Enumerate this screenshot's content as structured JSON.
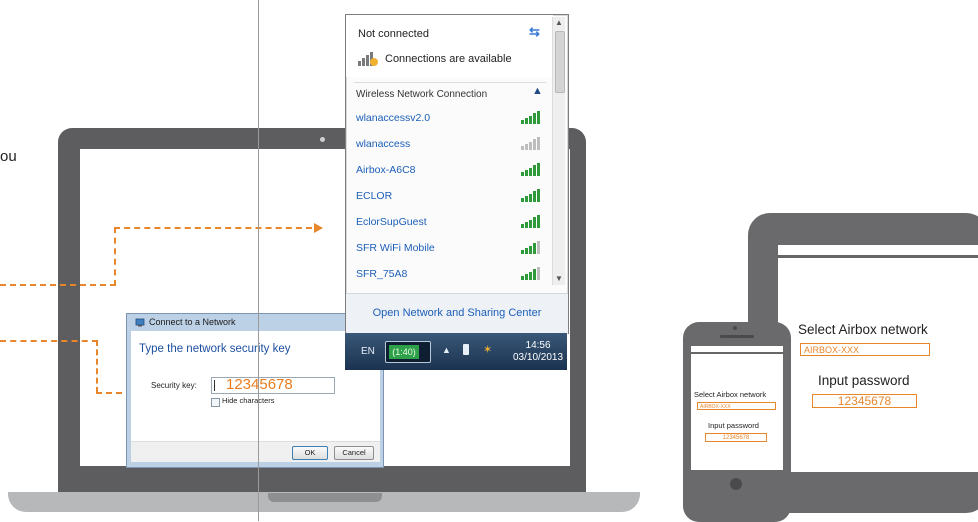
{
  "side_text": "ou",
  "flyout": {
    "status": "Not connected",
    "available": "Connections are available",
    "section": "Wireless Network Connection",
    "networks": [
      {
        "name": "wlanaccessv2.0",
        "signal": 5
      },
      {
        "name": "wlanaccess",
        "signal": 5
      },
      {
        "name": "Airbox-A6C8",
        "signal": 5
      },
      {
        "name": "ECLOR",
        "signal": 5
      },
      {
        "name": "EclorSupGuest",
        "signal": 5
      },
      {
        "name": "SFR WiFi Mobile",
        "signal": 4
      },
      {
        "name": "SFR_75A8",
        "signal": 4
      }
    ],
    "footer_link": "Open Network and Sharing Center"
  },
  "taskbar": {
    "lang": "EN",
    "battery": "(1:40)",
    "time": "14:56",
    "date": "03/10/2013"
  },
  "dialog": {
    "title": "Connect to a Network",
    "heading": "Type the network security key",
    "key_label": "Security key:",
    "key_value": "12345678",
    "hide_label": "Hide characters",
    "ok": "OK",
    "cancel": "Cancel"
  },
  "tablet": {
    "select_label": "Select Airbox network",
    "network_value": "AIRBOX-XXX",
    "password_label": "Input password",
    "password_value": "12345678"
  },
  "phone": {
    "select_label": "Select Airbox network",
    "network_value": "AIRBOX-XXX",
    "password_label": "Input password",
    "password_value": "12345678"
  },
  "colors": {
    "accent": "#e8862c",
    "link": "#1d5fb8"
  }
}
